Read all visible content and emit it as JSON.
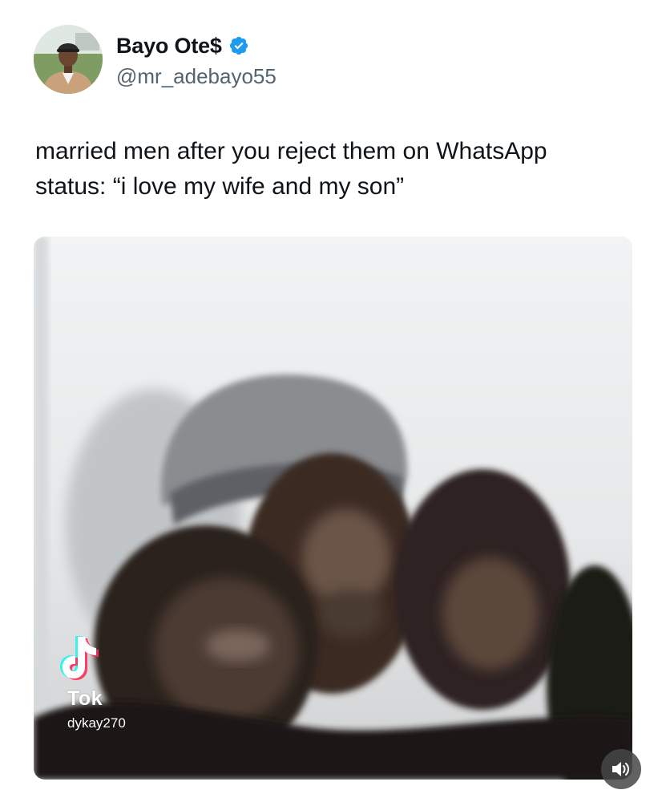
{
  "author": {
    "display_name": "Bayo Ote$",
    "handle": "@mr_adebayo55",
    "avatar_icon": "profile-avatar",
    "verified_icon": "verified-badge-icon",
    "verified_color": "#1d9bf0"
  },
  "tweet": {
    "line1": "married men after you reject them on WhatsApp",
    "line2": "status: “i love my wife and my son”"
  },
  "media": {
    "type": "video",
    "watermark_brand": "Tok",
    "watermark_user": "dykay270",
    "watermark_icon": "tiktok-logo-icon",
    "volume_icon": "speaker-volume-icon"
  },
  "colors": {
    "text_primary": "#0f1419",
    "text_secondary": "#536471",
    "background": "#ffffff"
  }
}
